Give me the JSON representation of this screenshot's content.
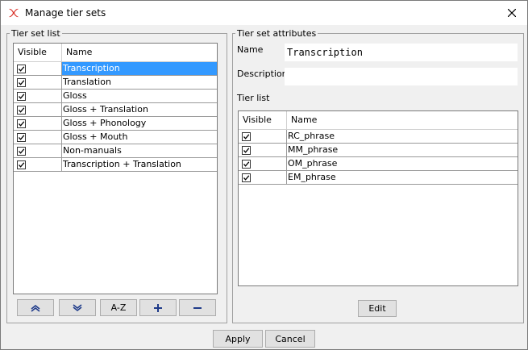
{
  "window": {
    "title": "Manage tier sets"
  },
  "left_panel": {
    "legend": "Tier set list",
    "columns": {
      "visible": "Visible",
      "name": "Name"
    },
    "rows": [
      {
        "name": "Transcription",
        "visible": true,
        "selected": true
      },
      {
        "name": "Translation",
        "visible": true
      },
      {
        "name": "Gloss",
        "visible": true
      },
      {
        "name": "Gloss + Translation",
        "visible": true
      },
      {
        "name": "Gloss + Phonology",
        "visible": true
      },
      {
        "name": "Gloss + Mouth",
        "visible": true
      },
      {
        "name": "Non-manuals",
        "visible": true
      },
      {
        "name": "Transcription + Translation",
        "visible": true
      }
    ],
    "buttons": {
      "move_up_icon": "chevron-up-icon",
      "move_down_icon": "chevron-down-icon",
      "sort_label": "A-Z",
      "add_icon": "plus-icon",
      "remove_icon": "minus-icon"
    }
  },
  "right_panel": {
    "legend": "Tier set attributes",
    "name_label": "Name",
    "name_value": "Transcription",
    "description_label": "Description",
    "description_value": "",
    "tier_list_label": "Tier list",
    "columns": {
      "visible": "Visible",
      "name": "Name"
    },
    "rows": [
      {
        "name": "RC_phrase",
        "visible": true
      },
      {
        "name": "MM_phrase",
        "visible": true
      },
      {
        "name": "OM_phrase",
        "visible": true
      },
      {
        "name": "EM_phrase",
        "visible": true
      }
    ],
    "edit_label": "Edit"
  },
  "footer": {
    "apply_label": "Apply",
    "cancel_label": "Cancel"
  },
  "colors": {
    "selection": "#3399ff",
    "button_face": "#e1e1e1",
    "accent_icon": "#d9342b"
  }
}
